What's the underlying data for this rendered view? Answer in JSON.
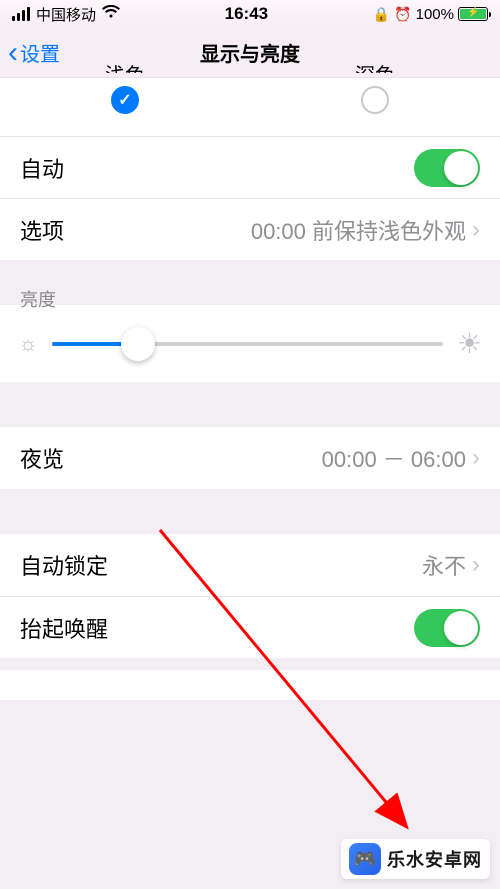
{
  "status": {
    "carrier": "中国移动",
    "time": "16:43",
    "battery_percent": "100%",
    "icons": {
      "lock": "⊙",
      "alarm": "⏰"
    }
  },
  "nav": {
    "back_label": "设置",
    "title": "显示与亮度"
  },
  "appearance": {
    "light_label": "浅色",
    "dark_label": "深色",
    "selected": "light"
  },
  "rows": {
    "auto": {
      "label": "自动",
      "toggle": true
    },
    "options": {
      "label": "选项",
      "value": "00:00 前保持浅色外观"
    },
    "brightness_header": "亮度",
    "night_shift": {
      "label": "夜览",
      "value": "00:00 － 06:00"
    },
    "auto_lock": {
      "label": "自动锁定",
      "value": "永不"
    },
    "raise_to_wake": {
      "label": "抬起唤醒",
      "toggle": true
    }
  },
  "watermark": {
    "text": "乐水安卓网"
  }
}
